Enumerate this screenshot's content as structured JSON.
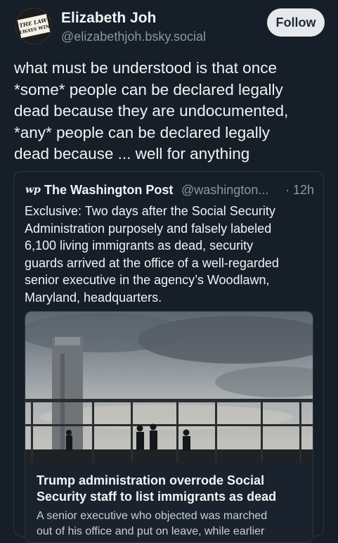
{
  "author": {
    "name": "Elizabeth Joh",
    "handle": "@elizabethjoh.bsky.social",
    "avatar_text": "THE LAW ALWAYS WINS",
    "follow_label": "Follow"
  },
  "post": {
    "lines": [
      "what must be understood is that once",
      "*some* people can be declared legally",
      "dead because they are undocumented,",
      "*any* people can be declared legally",
      "dead because ... well for anything"
    ]
  },
  "quote": {
    "logo_text": "wp",
    "name": "The Washington Post",
    "handle": "@washington...",
    "time": "· 12h",
    "lines": [
      "Exclusive: Two days after the Social Security",
      "Administration purposely and falsely labeled",
      "6,100 living immigrants as dead, security",
      "guards arrived at the office of a well-regarded",
      "senior executive in the agency’s Woodlawn,",
      "Maryland, headquarters."
    ],
    "link": {
      "title_lines": [
        "Trump administration overrode Social",
        "Security staff to list immigrants as dead"
      ],
      "desc_lines": [
        "A senior executive who objected was marched",
        "out of his office and put on leave, while earlier"
      ]
    }
  },
  "colors": {
    "background": "#161e27",
    "text": "#f1f3f5",
    "muted": "#8a97a5",
    "border": "#2b3744",
    "follow_bg": "#e6e9ec"
  }
}
